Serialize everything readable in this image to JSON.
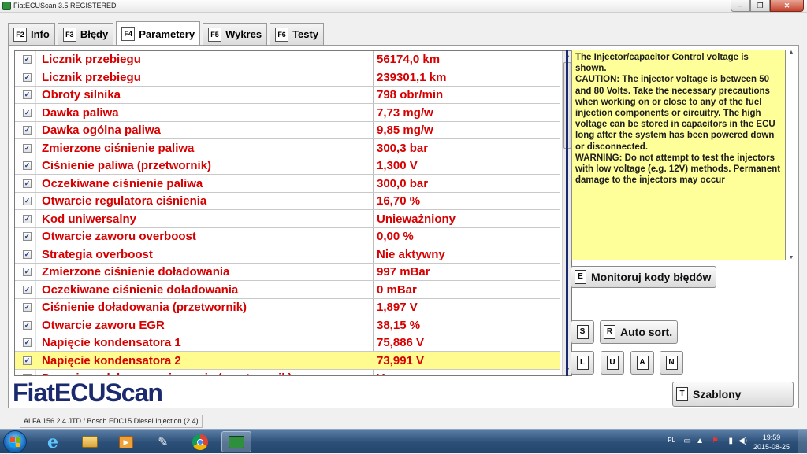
{
  "window": {
    "title": "FiatECUScan 3.5 REGISTERED",
    "minimize": "–",
    "maximize": "❐",
    "close": "✕"
  },
  "tabs": [
    {
      "key": "F2",
      "label": "Info",
      "active": false
    },
    {
      "key": "F3",
      "label": "Błędy",
      "active": false
    },
    {
      "key": "F4",
      "label": "Parametery",
      "active": true
    },
    {
      "key": "F5",
      "label": "Wykres",
      "active": false
    },
    {
      "key": "F6",
      "label": "Testy",
      "active": false
    }
  ],
  "parameters": [
    {
      "name": "Licznik przebiegu",
      "value": "56174,0 km",
      "checked": true
    },
    {
      "name": "Licznik przebiegu",
      "value": "239301,1 km",
      "checked": true
    },
    {
      "name": "Obroty silnika",
      "value": "798 obr/min",
      "checked": true
    },
    {
      "name": "Dawka paliwa",
      "value": "7,73 mg/w",
      "checked": true
    },
    {
      "name": "Dawka ogólna paliwa",
      "value": "9,85 mg/w",
      "checked": true
    },
    {
      "name": "Zmierzone ciśnienie paliwa",
      "value": "300,3 bar",
      "checked": true
    },
    {
      "name": "Ciśnienie paliwa (przetwornik)",
      "value": "1,300 V",
      "checked": true
    },
    {
      "name": "Oczekiwane ciśnienie paliwa",
      "value": "300,0 bar",
      "checked": true
    },
    {
      "name": "Otwarcie regulatora ciśnienia",
      "value": "16,70 %",
      "checked": true
    },
    {
      "name": "Kod uniwersalny",
      "value": "Unieważniony",
      "checked": true
    },
    {
      "name": "Otwarcie zaworu overboost",
      "value": "0,00 %",
      "checked": true
    },
    {
      "name": "Strategia overboost",
      "value": "Nie aktywny",
      "checked": true
    },
    {
      "name": "Zmierzone ciśnienie doładowania",
      "value": "997 mBar",
      "checked": true
    },
    {
      "name": "Oczekiwane ciśnienie doładowania",
      "value": "0 mBar",
      "checked": true
    },
    {
      "name": "Ciśnienie doładowania (przetwornik)",
      "value": "1,897 V",
      "checked": true
    },
    {
      "name": "Otwarcie zaworu EGR",
      "value": "38,15 %",
      "checked": true
    },
    {
      "name": "Napięcie kondensatora 1",
      "value": "75,886 V",
      "checked": true
    },
    {
      "name": "Napięcie kondensatora 2",
      "value": "73,991 V",
      "checked": true,
      "highlighted": true
    },
    {
      "name": "Pozycja pedału przyspieszenia (przetwornik)",
      "value": "V",
      "checked": true
    }
  ],
  "info_text": "The Injector/capacitor Control voltage is shown.\nCAUTION: The injector voltage is between 50 and 80 Volts. Take the necessary precautions when working on or close to any of the fuel injection components or circuitry. The high voltage can be stored in capacitors in the ECU long after the system has been powered down or disconnected.\nWARNING: Do not attempt to test the injectors with low voltage (e.g. 12V) methods. Permanent damage to the injectors may occur",
  "buttons": {
    "monitor": {
      "key": "E",
      "label": "Monitoruj kody błędów"
    },
    "s": {
      "key": "S"
    },
    "auto_sort": {
      "key": "R",
      "label": "Auto sort."
    },
    "l": {
      "key": "L"
    },
    "u": {
      "key": "U"
    },
    "a": {
      "key": "A"
    },
    "n": {
      "key": "N"
    },
    "templates": {
      "key": "T",
      "label": "Szablony"
    }
  },
  "logo": "FiatECUScan",
  "status": {
    "vehicle": "ALFA 156 2.4 JTD / Bosch EDC15 Diesel Injection (2.4)"
  },
  "taskbar": {
    "icons": [
      "ie-icon",
      "explorer-icon",
      "media-player-icon",
      "tools-icon",
      "chrome-icon",
      "fiatecuscan-icon"
    ],
    "lang": "PL",
    "time": "19:59",
    "date": "2015-08-25"
  },
  "colors": {
    "param_text": "#d70000",
    "highlight": "#fffb8e",
    "info_bg": "#ffff99",
    "brand": "#1b2a6e"
  }
}
